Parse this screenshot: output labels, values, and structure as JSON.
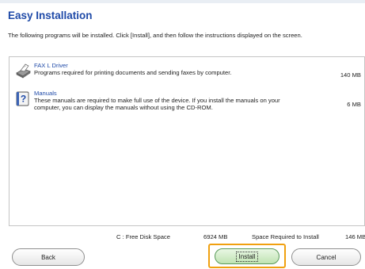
{
  "header": {
    "title": "Easy Installation",
    "intro": "The following programs will be installed. Click [Install], and then follow the instructions displayed on the screen."
  },
  "items": [
    {
      "icon": "fax-driver-icon",
      "name": "FAX L Driver",
      "description": "Programs required for printing documents and sending faxes by computer.",
      "size": "140 MB"
    },
    {
      "icon": "manual-help-icon",
      "name": "Manuals",
      "description": "These manuals are required to make full use of the device. If you install the manuals on your computer, you can display the manuals without using the CD-ROM.",
      "size": "6 MB"
    }
  ],
  "footer": {
    "free_disk_label": "C : Free Disk Space",
    "free_disk_value": "6924 MB",
    "required_label": "Space Required to Install",
    "required_value": "146 MB"
  },
  "buttons": {
    "back": "Back",
    "install": "Install",
    "cancel": "Cancel"
  },
  "colors": {
    "title": "#1f4aa8",
    "focus": "#f0a010",
    "install_bg": "#bfe3b2"
  }
}
